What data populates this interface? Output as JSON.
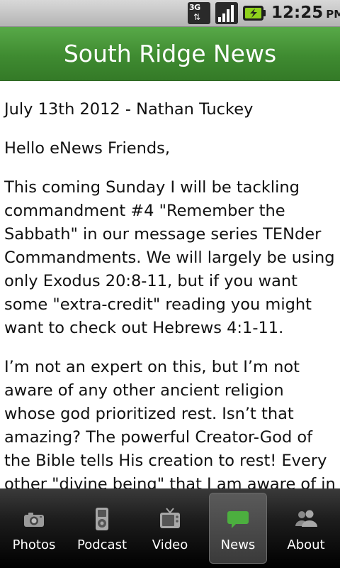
{
  "status_bar": {
    "network_type": "3G",
    "time": "12:25",
    "ampm": "PM",
    "icons": [
      "network-3g-icon",
      "signal-strength-icon",
      "battery-charging-icon"
    ]
  },
  "app": {
    "title": "South Ridge News",
    "accent_color": "#3f8b31"
  },
  "article": {
    "paragraphs": [
      "July 13th 2012 - Nathan Tuckey",
      "Hello eNews Friends,",
      "This coming Sunday I will be tackling commandment #4 \"Remember the Sabbath\" in our message series TENder Commandments. We will largely be using only Exodus 20:8-11, but if you want some \"extra-credit\" reading you might want to check out Hebrews 4:1-11.",
      "I’m not an expert on this, but I’m not aware of any other ancient religion whose god prioritized rest. Isn’t that amazing? The powerful Creator-God of the Bible tells His creation to rest! Every other \"divine being\" that I am aware of in"
    ]
  },
  "tabs": [
    {
      "label": "Photos",
      "icon": "camera-icon",
      "selected": false
    },
    {
      "label": "Podcast",
      "icon": "media-player-icon",
      "selected": false
    },
    {
      "label": "Video",
      "icon": "television-icon",
      "selected": false
    },
    {
      "label": "News",
      "icon": "speech-bubble-icon",
      "selected": true
    },
    {
      "label": "About",
      "icon": "people-icon",
      "selected": false
    }
  ]
}
